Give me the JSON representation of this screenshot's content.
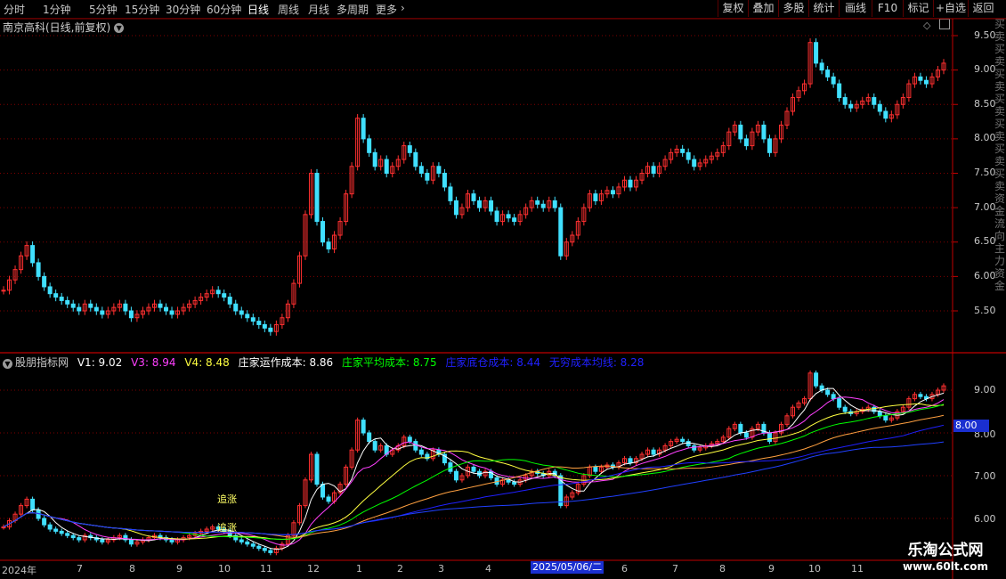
{
  "toolbar": {
    "timeframes": [
      "分时",
      "1分钟",
      "5分钟",
      "15分钟",
      "30分钟",
      "60分钟",
      "日线",
      "周线",
      "月线",
      "多周期",
      "更多"
    ],
    "active": "日线",
    "right_buttons": [
      "复权",
      "叠加",
      "多股",
      "统计",
      "画线",
      "F10",
      "标记",
      "+自选",
      "返回"
    ]
  },
  "main_title": "南京高科(日线,前复权)",
  "indicator": {
    "name": "股朋指标网",
    "items": [
      {
        "label": "V1: 9.02",
        "color": "#ffffff"
      },
      {
        "label": "V3: 8.94",
        "color": "#ff40ff"
      },
      {
        "label": "V4: 8.48",
        "color": "#ffff40"
      },
      {
        "label": "庄家运作成本: 8.86",
        "color": "#ffffff"
      },
      {
        "label": "庄家平均成本: 8.75",
        "color": "#00ff00"
      },
      {
        "label": "庄家底仓成本: 8.44",
        "color": "#2020ff"
      },
      {
        "label": "无穷成本均线: 8.28",
        "color": "#2020ff"
      }
    ],
    "annotations": [
      "追涨",
      "追涨"
    ]
  },
  "price_axis": [
    "9.50",
    "9.00",
    "8.50",
    "8.00",
    "7.50",
    "7.00",
    "6.50",
    "6.00",
    "5.50"
  ],
  "indicator_axis": [
    "9.00",
    "8.00",
    "7.00",
    "6.00"
  ],
  "current_value": "8.00",
  "date_axis": [
    "2024年",
    "7",
    "8",
    "9",
    "10",
    "11",
    "12",
    "1",
    "2",
    "3",
    "4",
    "5",
    "6",
    "7",
    "8",
    "9",
    "10",
    "11",
    "12"
  ],
  "cursor_date": "2025/05/06/二",
  "watermark": {
    "line1": "乐淘公式网",
    "line2": "www.60lt.com"
  },
  "right_strip": "买卖买卖买卖买卖买卖买卖买卖资金流向主力资金",
  "colors": {
    "up": "#ff3030",
    "down": "#40e0ff",
    "grid": "#800000",
    "accent": "#1a2fd0"
  },
  "chart_data": {
    "type": "candlestick",
    "title": "南京高科(日线,前复权)",
    "ylim": [
      5.1,
      9.6
    ],
    "closes": [
      5.8,
      5.95,
      6.1,
      6.3,
      6.45,
      6.2,
      6.0,
      5.85,
      5.75,
      5.7,
      5.65,
      5.6,
      5.55,
      5.5,
      5.6,
      5.55,
      5.5,
      5.45,
      5.5,
      5.55,
      5.6,
      5.5,
      5.4,
      5.45,
      5.5,
      5.55,
      5.6,
      5.55,
      5.5,
      5.45,
      5.5,
      5.55,
      5.6,
      5.65,
      5.7,
      5.75,
      5.8,
      5.75,
      5.7,
      5.6,
      5.5,
      5.45,
      5.4,
      5.35,
      5.3,
      5.25,
      5.2,
      5.3,
      5.4,
      5.6,
      5.9,
      6.3,
      6.9,
      7.5,
      6.8,
      6.5,
      6.4,
      6.6,
      6.8,
      7.2,
      7.6,
      8.3,
      8.0,
      7.8,
      7.6,
      7.7,
      7.5,
      7.6,
      7.7,
      7.9,
      7.8,
      7.6,
      7.5,
      7.4,
      7.6,
      7.5,
      7.3,
      7.1,
      6.9,
      7.0,
      7.2,
      7.1,
      7.0,
      7.1,
      6.95,
      6.8,
      6.9,
      6.85,
      6.8,
      6.9,
      7.0,
      7.1,
      7.05,
      7.0,
      7.1,
      7.0,
      6.3,
      6.5,
      6.6,
      6.8,
      7.0,
      7.2,
      7.1,
      7.2,
      7.25,
      7.2,
      7.3,
      7.4,
      7.3,
      7.4,
      7.5,
      7.6,
      7.5,
      7.6,
      7.7,
      7.8,
      7.85,
      7.8,
      7.7,
      7.6,
      7.65,
      7.7,
      7.75,
      7.8,
      7.9,
      8.1,
      8.2,
      8.0,
      7.9,
      8.1,
      8.2,
      8.0,
      7.8,
      8.0,
      8.2,
      8.4,
      8.6,
      8.7,
      8.8,
      9.4,
      9.1,
      9.0,
      8.9,
      8.8,
      8.6,
      8.5,
      8.45,
      8.5,
      8.55,
      8.6,
      8.5,
      8.4,
      8.3,
      8.35,
      8.5,
      8.6,
      8.8,
      8.9,
      8.85,
      8.8,
      8.9,
      9.0,
      9.1
    ],
    "series": [
      {
        "name": "V1",
        "value": 9.02
      },
      {
        "name": "V3",
        "value": 8.94
      },
      {
        "name": "V4",
        "value": 8.48
      },
      {
        "name": "庄家运作成本",
        "value": 8.86
      },
      {
        "name": "庄家平均成本",
        "value": 8.75
      },
      {
        "name": "庄家底仓成本",
        "value": 8.44
      },
      {
        "name": "无穷成本均线",
        "value": 8.28
      }
    ]
  }
}
